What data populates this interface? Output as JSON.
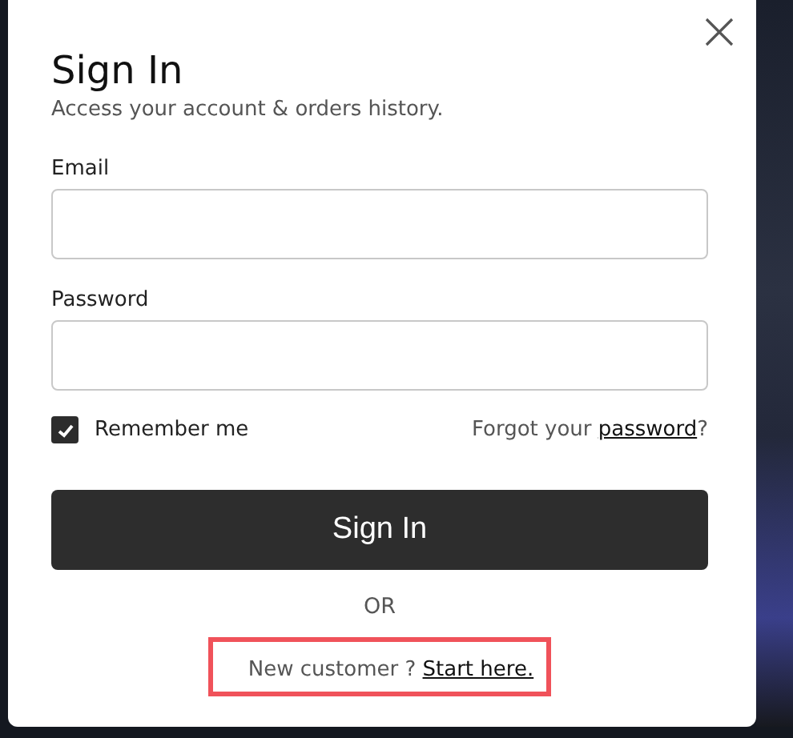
{
  "dialog": {
    "title": "Sign In",
    "subtitle": "Access your account & orders history.",
    "fields": [
      {
        "label": "Email"
      },
      {
        "label": "Password"
      }
    ],
    "remember": {
      "label": "Remember me",
      "checked": true
    },
    "forgot": {
      "text": "Forgot your",
      "link": "password",
      "suffix": "?"
    },
    "submit": "Sign In",
    "separator": "OR",
    "signup": {
      "text": "New customer ?",
      "link": "Start here.",
      "highlighted": true
    }
  }
}
